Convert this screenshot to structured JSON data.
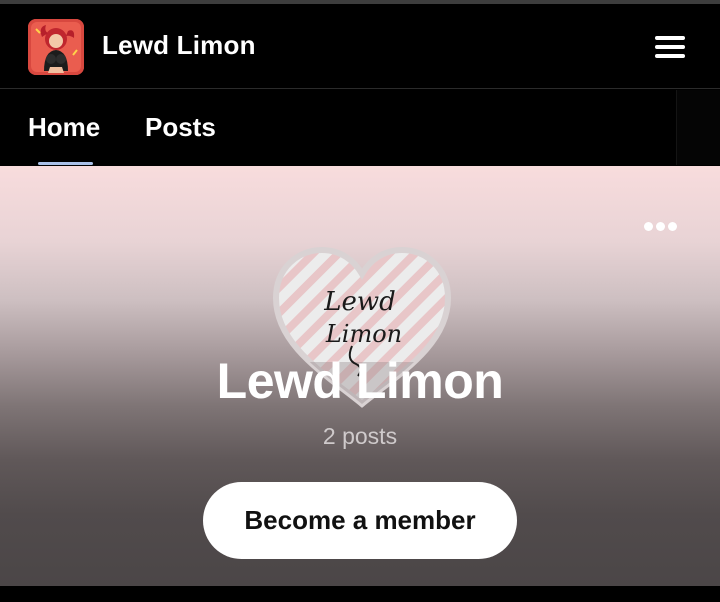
{
  "header": {
    "title": "Lewd Limon",
    "avatar_icon": "creator-avatar",
    "menu_icon": "hamburger-menu-icon"
  },
  "tabs": [
    {
      "label": "Home",
      "active": true
    },
    {
      "label": "Posts",
      "active": false
    }
  ],
  "banner": {
    "logo_text_line1": "Lewd",
    "logo_text_line2": "Limon",
    "creator_name": "Lewd Limon",
    "post_count": "2 posts",
    "cta_label": "Become a member",
    "more_icon": "more-dots-icon"
  },
  "colors": {
    "background": "#000000",
    "tab_indicator": "#a9c0e8",
    "banner_top": "#f8dcdd",
    "banner_bottom": "#4b4647",
    "cta_background": "#ffffff"
  }
}
